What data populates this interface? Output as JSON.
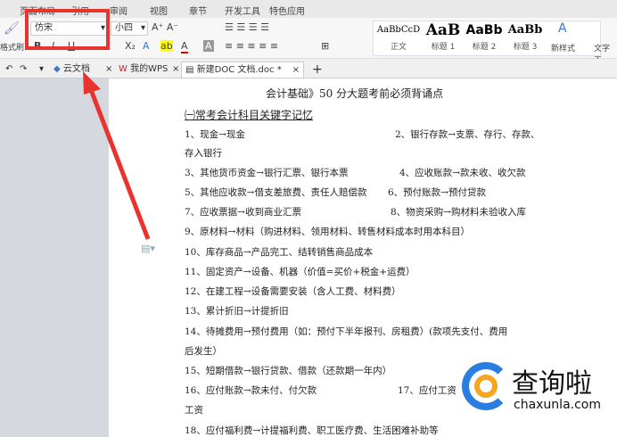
{
  "menu": [
    "页面布局",
    "引用",
    "审阅",
    "视图",
    "章节",
    "开发工具",
    "特色应用"
  ],
  "ribbon": {
    "format_painter": "格式刷",
    "font": "仿宋",
    "size": "小四",
    "styles": [
      {
        "sample": "AaBbCcD",
        "label": "正文"
      },
      {
        "sample": "AaB",
        "label": "标题 1"
      },
      {
        "sample": "AaBb",
        "label": "标题 2"
      },
      {
        "sample": "AaBb",
        "label": "标题 3"
      }
    ],
    "new_style": "新样式",
    "text_tools": "文字工"
  },
  "tabs": [
    {
      "label": "云文档"
    },
    {
      "label": "我的WPS"
    },
    {
      "label": "新建DOC 文档.doc *"
    }
  ],
  "document": {
    "title": "会计基础》50 分大题考前必须背诵点",
    "heading": "㈠常考会计科目关键字记忆",
    "lines": [
      {
        "a": "1、现金→现金",
        "b": "2、银行存款→支票、存行、存款、"
      },
      {
        "a": "存入银行",
        "b": ""
      },
      {
        "a": "3、其他货币资金→银行汇票、银行本票",
        "b": "4、应收账款→款未收、收欠款"
      },
      {
        "a": "5、其他应收款→借支差旅费、责任人赔偿款",
        "b": "6、预付账款→预付贷款"
      },
      {
        "a": "7、应收票据→收到商业汇票",
        "b": "8、物资采购→购材料未验收入库"
      },
      {
        "a": "9、原材料→材料（购进材料、领用材料、转售材料成本时用本科目）",
        "b": ""
      },
      {
        "a": "10、库存商品→产品完工、结转销售商品成本",
        "b": ""
      },
      {
        "a": "11、固定资产→设备、机器（价值=买价+税金+运费）",
        "b": ""
      },
      {
        "a": "12、在建工程→设备需要安装（含人工费、材料费）",
        "b": ""
      },
      {
        "a": "13、累计折旧→计提折旧",
        "b": ""
      },
      {
        "a": "14、待摊费用→预付费用（如：预付下半年报刊、房租费）(款项先支付、费用",
        "b": ""
      },
      {
        "a": "后发生）",
        "b": ""
      },
      {
        "a": "15、短期借款→银行贷款、借款（还款期一年内）",
        "b": ""
      },
      {
        "a": "16、应付账款→款未付、付欠款",
        "b": "17、应付工资"
      },
      {
        "a": "工资",
        "b": ""
      },
      {
        "a": "18、应付福利费→计提福利费、职工医疗费、生活困难补助等",
        "b": ""
      }
    ]
  },
  "watermark": {
    "name": "查询啦",
    "domain": "chaxunla.com"
  },
  "colors": {
    "highlight": "#e8332f",
    "logo_blue": "#2a7de1",
    "logo_orange": "#f5a623"
  }
}
